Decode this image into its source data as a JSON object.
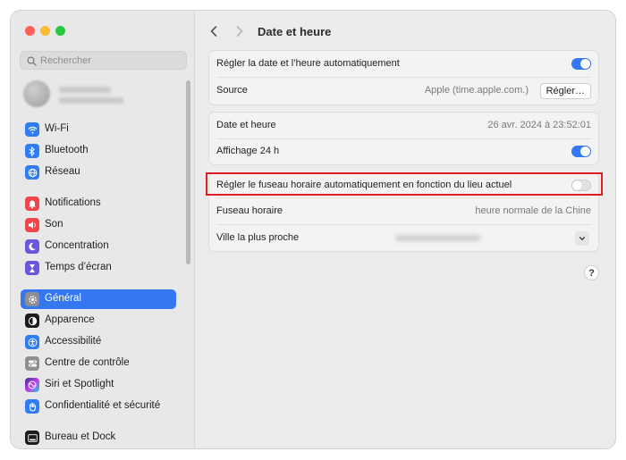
{
  "search": {
    "placeholder": "Rechercher"
  },
  "sidebar": {
    "items": [
      {
        "label": "Wi‑Fi",
        "icon": "wifi-icon",
        "color": "#2f7cf6"
      },
      {
        "label": "Bluetooth",
        "icon": "bluetooth-icon",
        "color": "#2f7cf6"
      },
      {
        "label": "Réseau",
        "icon": "globe-icon",
        "color": "#2f7cf6"
      },
      {
        "label": "Notifications",
        "icon": "bell-icon",
        "color": "#f0454a"
      },
      {
        "label": "Son",
        "icon": "speaker-icon",
        "color": "#f0454a"
      },
      {
        "label": "Concentration",
        "icon": "moon-icon",
        "color": "#6a56d6"
      },
      {
        "label": "Temps d’écran",
        "icon": "hourglass-icon",
        "color": "#6a56d6"
      },
      {
        "label": "Général",
        "icon": "gear-icon",
        "color": "#8e8e93"
      },
      {
        "label": "Apparence",
        "icon": "appearance-icon",
        "color": "#1c1c1e"
      },
      {
        "label": "Accessibilité",
        "icon": "accessibility-icon",
        "color": "#2f7cf6"
      },
      {
        "label": "Centre de contrôle",
        "icon": "control-center-icon",
        "color": "#8e8e93"
      },
      {
        "label": "Siri et Spotlight",
        "icon": "siri-icon",
        "color": "#c23be8"
      },
      {
        "label": "Confidentialité et sécurité",
        "icon": "hand-icon",
        "color": "#2f7cf6"
      },
      {
        "label": "Bureau et Dock",
        "icon": "dock-icon",
        "color": "#1c1c1e"
      }
    ],
    "active": "Général"
  },
  "header": {
    "title": "Date et heure"
  },
  "panel1": {
    "auto_label": "Régler la date et l’heure automatiquement",
    "auto_on": true,
    "source_label": "Source",
    "source_value": "Apple (time.apple.com.)",
    "set_button": "Régler…"
  },
  "panel2": {
    "date_label": "Date et heure",
    "date_value": "26 avr. 2024 à 23:52:01",
    "h24_label": "Affichage 24 h",
    "h24_on": true
  },
  "panel3": {
    "tz_auto_label": "Régler le fuseau horaire automatiquement en fonction du lieu actuel",
    "tz_auto_on": false,
    "tz_label": "Fuseau horaire",
    "tz_value": "heure normale de la Chine",
    "city_label": "Ville la plus proche"
  },
  "help": "?",
  "colors": {
    "accent": "#3478f6",
    "highlight": "#e21c24"
  }
}
